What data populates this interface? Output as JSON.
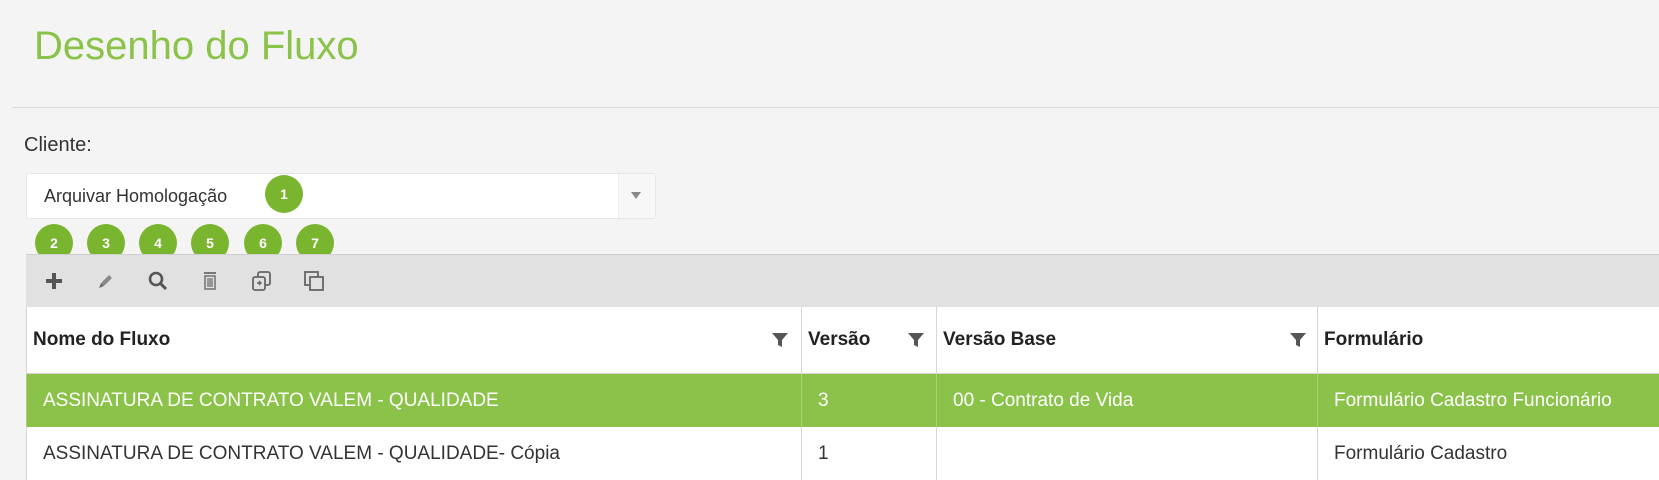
{
  "page": {
    "title": "Desenho do Fluxo"
  },
  "client": {
    "label": "Cliente:",
    "selected": "Arquivar Homologação"
  },
  "badges": [
    "1",
    "2",
    "3",
    "4",
    "5",
    "6",
    "7"
  ],
  "toolbar": {
    "tools": [
      {
        "name": "add-icon"
      },
      {
        "name": "edit-icon"
      },
      {
        "name": "search-icon"
      },
      {
        "name": "delete-icon"
      },
      {
        "name": "copy-version-icon"
      },
      {
        "name": "duplicate-icon"
      }
    ]
  },
  "grid": {
    "columns": [
      "Nome do Fluxo",
      "Versão",
      "Versão Base",
      "Formulário"
    ],
    "rows": [
      {
        "selected": true,
        "cells": [
          "ASSINATURA DE CONTRATO VALEM - QUALIDADE",
          "3",
          "00 - Contrato de Vida",
          "Formulário Cadastro Funcionário"
        ]
      },
      {
        "selected": false,
        "cells": [
          "ASSINATURA DE CONTRATO VALEM - QUALIDADE- Cópia",
          "1",
          "",
          "Formulário Cadastro"
        ]
      }
    ]
  },
  "colors": {
    "accent": "#8bc34a",
    "badge": "#7ab530"
  }
}
